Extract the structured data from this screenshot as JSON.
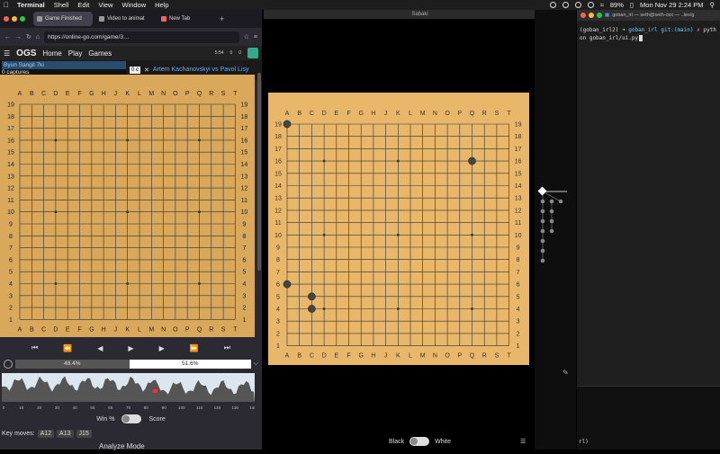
{
  "menubar": {
    "app": "Terminal",
    "items": [
      "Shell",
      "Edit",
      "View",
      "Window",
      "Help"
    ],
    "battery": "89%",
    "datetime": "Mon Nov 29  2:24 PM"
  },
  "browser": {
    "tabs": [
      {
        "label": "Game Finished"
      },
      {
        "label": "Video to animat"
      },
      {
        "label": "New Tab"
      }
    ],
    "url": "https://online-go.com/game/3…",
    "nav": {
      "logo": "OGS",
      "home": "Home",
      "play": "Play",
      "games": "Games",
      "stat1": "5:54",
      "stat2": "0",
      "stat3": "0"
    },
    "players": {
      "left_name": "Byun Sangil 7ki",
      "left_captures": "0 captures",
      "right_name": "Artem Kachanovskyi vs Pavol Lisy",
      "badge": "0 c"
    },
    "columns": [
      "A",
      "B",
      "C",
      "D",
      "E",
      "F",
      "G",
      "H",
      "J",
      "K",
      "L",
      "M",
      "N",
      "O",
      "P",
      "Q",
      "R",
      "S",
      "T"
    ],
    "rows": [
      "19",
      "18",
      "17",
      "16",
      "15",
      "14",
      "13",
      "12",
      "11",
      "10",
      "9",
      "8",
      "7",
      "6",
      "5",
      "4",
      "3",
      "2",
      "1"
    ],
    "winrate": {
      "black": "48.4%",
      "white": "51.6%"
    },
    "graph_ticks": [
      "0",
      "10",
      "20",
      "30",
      "40",
      "50",
      "60",
      "70",
      "80",
      "90",
      "100",
      "110",
      "120",
      "130",
      "140"
    ],
    "toggle": {
      "left": "Win %",
      "right": "Score"
    },
    "keymoves": {
      "label": "Key moves:",
      "moves": [
        "A12",
        "A13",
        "J15"
      ]
    },
    "analyze": "Analyze Mode"
  },
  "sabaki": {
    "title": "Sabaki",
    "stones": [
      {
        "col": "A",
        "row": 19
      },
      {
        "col": "Q",
        "row": 16
      },
      {
        "col": "A",
        "row": 6
      },
      {
        "col": "C",
        "row": 5
      },
      {
        "col": "C",
        "row": 4
      }
    ],
    "bottom": {
      "black": "Black",
      "white": "White"
    }
  },
  "terminal": {
    "title": "goban_irl — seth@seth-osx — ..les/g",
    "line1_env": "(goban_irl2)",
    "line1_dir": "goban_irl",
    "line1_git": "git:(main)",
    "line1_x": "✗",
    "line1_cmd": "pyth",
    "line2": "on goban_irl/ui.py",
    "lower_text": "rl)"
  }
}
